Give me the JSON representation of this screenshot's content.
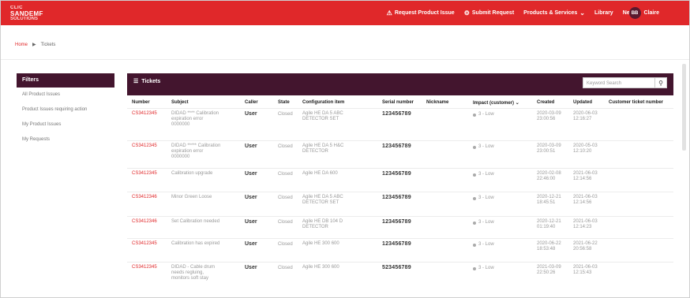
{
  "app": {
    "logo_line1": "CLIC",
    "logo_line2": "SANDEMF",
    "logo_line3": "SOLUTIONS"
  },
  "nav": {
    "items": [
      {
        "label": "Request Product Issue",
        "icon": "warning-icon"
      },
      {
        "label": "Submit Request",
        "icon": "gear-icon"
      },
      {
        "label": "Products & Services",
        "dropdown": true
      },
      {
        "label": "Library"
      },
      {
        "label": "News"
      }
    ],
    "user_initials": "BB",
    "user_label": "Claire"
  },
  "breadcrumb": {
    "home": "Home",
    "sep": "▶",
    "current": "Tickets"
  },
  "sidebar": {
    "title": "Filters",
    "items": [
      "All Product Issues",
      "Product Issues requiring action",
      "My Product Issues",
      "My Requests"
    ]
  },
  "panel": {
    "title": "Tickets",
    "search_placeholder": "Keyword Search"
  },
  "columns": [
    "Number",
    "Subject",
    "Caller",
    "State",
    "Configuration item",
    "Serial number",
    "Nickname",
    "Impact (customer)",
    "Created",
    "Updated",
    "Customer ticket number"
  ],
  "rows": [
    {
      "number": "CS3412345",
      "subject": [
        "DIDAD **** Calibration",
        "expiration error",
        "0000000"
      ],
      "caller": "User",
      "state": "Closed",
      "config": [
        "Agile HE DA 5 ABC",
        "DETECTOR SET"
      ],
      "serial": "123456789",
      "impact": "3 - Low",
      "created": [
        "2020-03-09",
        "23:00:56"
      ],
      "updated": [
        "2020-06-03",
        "12:16:27"
      ]
    },
    {
      "number": "CS3412345",
      "subject": [
        "DIDAD ***** Calibration",
        "expiration error",
        "0000000"
      ],
      "caller": "User",
      "state": "Closed",
      "config": [
        "Agile HE DA 5 H&C",
        "DETECTOR"
      ],
      "serial": "123456789",
      "impact": "3 - Low",
      "created": [
        "2020-03-09",
        "23:00:51"
      ],
      "updated": [
        "2020-05-03",
        "12:10:20"
      ]
    },
    {
      "number": "CS3412345",
      "subject": [
        "Calibration upgrade"
      ],
      "caller": "User",
      "state": "Closed",
      "config": [
        "Agile HE DA 600"
      ],
      "serial": "123456789",
      "impact": "3 - Low",
      "created": [
        "2020-02-08",
        "22:46:00"
      ],
      "updated": [
        "2021-06-03",
        "12:14:56"
      ]
    },
    {
      "number": "CS3412346",
      "subject": [
        "Minor Green Loose"
      ],
      "caller": "User",
      "state": "Closed",
      "config": [
        "Agile HE DA 5 ABC",
        "DETECTOR SET"
      ],
      "serial": "123456789",
      "impact": "3 - Low",
      "created": [
        "2020-12-21",
        "18:45:51"
      ],
      "updated": [
        "2021-06-03",
        "12:14:56"
      ]
    },
    {
      "number": "CS3412346",
      "subject": [
        "Set Calibration needed"
      ],
      "caller": "User",
      "state": "Closed",
      "config": [
        "Agile HE DB 104 D",
        "DETECTOR"
      ],
      "serial": "123456789",
      "impact": "3 - Low",
      "created": [
        "2020-12-21",
        "01:19:40"
      ],
      "updated": [
        "2021-06-03",
        "12:14:23"
      ]
    },
    {
      "number": "CS3412345",
      "subject": [
        "Calibration has expired"
      ],
      "caller": "User",
      "state": "Closed",
      "config": [
        "Agile HE 300 600"
      ],
      "serial": "123456789",
      "impact": "3 - Low",
      "created": [
        "2020-06-22",
        "18:53:48"
      ],
      "updated": [
        "2021-06-22",
        "20:56:58"
      ]
    },
    {
      "number": "CS3412345",
      "subject": [
        "DIDAD - Cable drum",
        "needs regluing,",
        "monitors soft stay"
      ],
      "caller": "User",
      "state": "Closed",
      "config": [
        "Agile HE 300 600"
      ],
      "serial": "523456789",
      "impact": "3 - Low",
      "created": [
        "2021-03-09",
        "22:50:26"
      ],
      "updated": [
        "2021-06-03",
        "12:15:43"
      ]
    }
  ]
}
